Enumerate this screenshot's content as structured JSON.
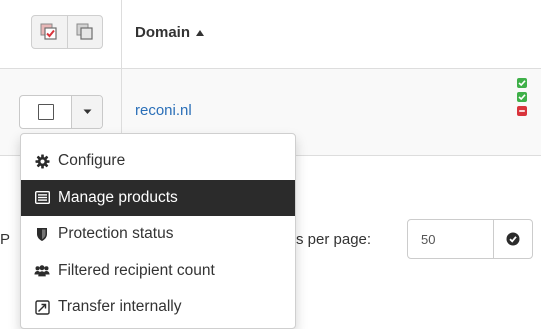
{
  "table": {
    "domain_header": "Domain",
    "rows": [
      {
        "domain": "reconi.nl"
      }
    ]
  },
  "status_colors": {
    "ok": "#3fb049",
    "error": "#d9343c"
  },
  "pager": {
    "prefix_text": "P",
    "per_page_text": "s per page:",
    "per_page_value": "50"
  },
  "dropdown": {
    "items": [
      {
        "label": "Configure",
        "icon": "gear-icon"
      },
      {
        "label": "Manage products",
        "icon": "list-icon",
        "active": true
      },
      {
        "label": "Protection status",
        "icon": "shield-icon"
      },
      {
        "label": "Filtered recipient count",
        "icon": "users-icon"
      },
      {
        "label": "Transfer internally",
        "icon": "transfer-icon"
      }
    ]
  }
}
